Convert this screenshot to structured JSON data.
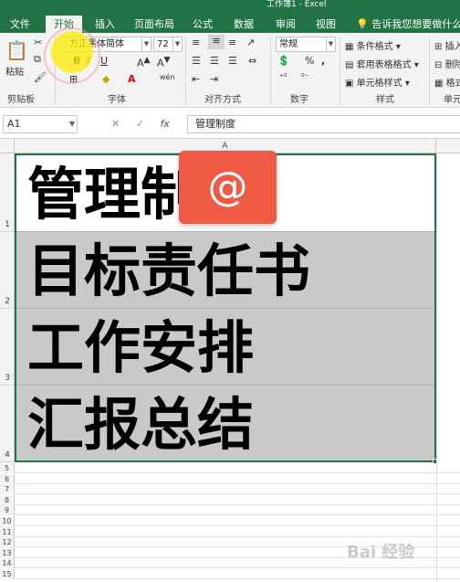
{
  "window": {
    "title": "工作簿1 - Excel"
  },
  "tabs": [
    {
      "label": "文件"
    },
    {
      "label": "开始"
    },
    {
      "label": "插入"
    },
    {
      "label": "页面布局"
    },
    {
      "label": "公式"
    },
    {
      "label": "数据"
    },
    {
      "label": "审阅"
    },
    {
      "label": "视图"
    }
  ],
  "tell_me": "告诉我您想要做什么...",
  "ribbon": {
    "clipboard": {
      "paste_label": "粘贴",
      "group_label": "剪贴板"
    },
    "font": {
      "font_name": "方正黑体简体",
      "font_size": "72",
      "group_label": "字体",
      "wen": "wén"
    },
    "alignment": {
      "group_label": "对齐方式"
    },
    "number": {
      "format": "常规",
      "group_label": "数字",
      "percent": "%"
    },
    "styles": {
      "conditional": "条件格式",
      "table_format": "套用表格格式",
      "cell_styles": "单元格样式",
      "group_label": "样式"
    },
    "cells": {
      "insert_label": "插入",
      "delete_label": "删除",
      "format_label": "格式",
      "group_label": "单元"
    }
  },
  "formula_bar": {
    "name_box": "A1",
    "content": "管理制度",
    "fx": "fx"
  },
  "grid": {
    "column_header": "A",
    "rows": [
      {
        "num": "1",
        "text": "管理制"
      },
      {
        "num": "2",
        "text": "目标责任书"
      },
      {
        "num": "3",
        "text": "工作安排"
      },
      {
        "num": "4",
        "text": "汇报总结"
      }
    ],
    "small_rows": [
      "5",
      "6",
      "7",
      "8",
      "9",
      "10",
      "11",
      "12",
      "13",
      "14",
      "15"
    ]
  },
  "badge": {
    "symbol": "@"
  },
  "watermark": "Bai 经验"
}
